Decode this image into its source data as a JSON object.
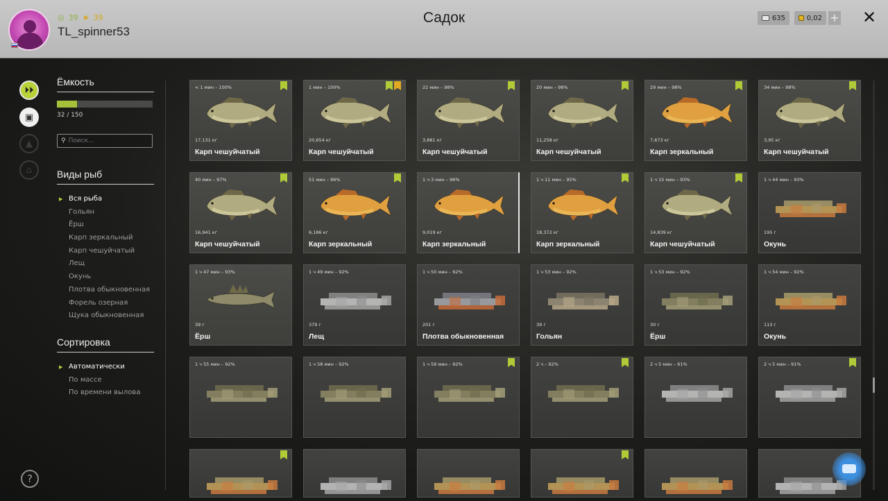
{
  "header": {
    "title": "Садок",
    "username": "TL_spinner53",
    "level": "39",
    "rank": "39",
    "silver": "635",
    "gold": "0,02",
    "plus": "+",
    "close": "✕"
  },
  "sidebar": {
    "capacity_title": "Ёмкость",
    "capacity_text": "32 / 150",
    "capacity_fraction": 0.213,
    "search_placeholder": "Поиск...",
    "species_title": "Виды рыб",
    "species": [
      "Вся рыба",
      "Гольян",
      "Ёрш",
      "Карп зеркальный",
      "Карп чешуйчатый",
      "Лещ",
      "Окунь",
      "Плотва обыкновенная",
      "Форель озерная",
      "Щука обыкновенная"
    ],
    "sort_title": "Сортировка",
    "sort_options": [
      "Автоматически",
      "По массе",
      "По времени вылова"
    ]
  },
  "help": "?",
  "colors": {
    "accent": "#b1cb38",
    "star": "#e3a923",
    "carp_scaled": "#b0ab80",
    "carp_mirror": "#e0a040",
    "perch": "#c9a35a"
  },
  "cards": [
    {
      "time": "< 1 мин – 100%",
      "weight": "17,131 кг",
      "name": "Карп чешуйчатый",
      "fish": "scaled",
      "badges": [
        "trophy"
      ]
    },
    {
      "time": "1 мин – 100%",
      "weight": "20,654 кг",
      "name": "Карп чешуйчатый",
      "fish": "scaled",
      "badges": [
        "trophy",
        "star"
      ]
    },
    {
      "time": "22 мин – 98%",
      "weight": "3,881 кг",
      "name": "Карп чешуйчатый",
      "fish": "scaled",
      "badges": [
        "trophy"
      ]
    },
    {
      "time": "20 мин – 98%",
      "weight": "11,258 кг",
      "name": "Карп чешуйчатый",
      "fish": "scaled",
      "badges": [
        "trophy"
      ]
    },
    {
      "time": "29 мин – 98%",
      "weight": "7,673 кг",
      "name": "Карп зеркальный",
      "fish": "mirror",
      "badges": [
        "trophy"
      ]
    },
    {
      "time": "34 мин – 98%",
      "weight": "3,95 кг",
      "name": "Карп чешуйчатый",
      "fish": "scaled",
      "badges": [
        "trophy"
      ]
    },
    {
      "time": "40 мин – 97%",
      "weight": "16,941 кг",
      "name": "Карп чешуйчатый",
      "fish": "scaled",
      "badges": [
        "trophy"
      ]
    },
    {
      "time": "51 мин – 96%",
      "weight": "6,186 кг",
      "name": "Карп зеркальный",
      "fish": "mirror",
      "badges": [
        "trophy"
      ]
    },
    {
      "time": "1 ч 3 мин – 96%",
      "weight": "9,019 кг",
      "name": "Карп зеркальный",
      "fish": "mirror",
      "badges": [],
      "selected": true
    },
    {
      "time": "1 ч 11 мин – 95%",
      "weight": "18,372 кг",
      "name": "Карп зеркальный",
      "fish": "mirror",
      "badges": [
        "trophy"
      ]
    },
    {
      "time": "1 ч 15 мин – 93%",
      "weight": "14,839 кг",
      "name": "Карп чешуйчатый",
      "fish": "scaled",
      "badges": [
        "trophy"
      ]
    },
    {
      "time": "1 ч 44 мин – 93%",
      "weight": "195 г",
      "name": "Окунь",
      "fish": "blur-perch",
      "badges": []
    },
    {
      "time": "1 ч 47 мин – 93%",
      "weight": "39 г",
      "name": "Ёрш",
      "fish": "ruffe",
      "badges": []
    },
    {
      "time": "1 ч 49 мин – 92%",
      "weight": "379 г",
      "name": "Лещ",
      "fish": "blur-white",
      "badges": []
    },
    {
      "time": "1 ч 50 мин – 92%",
      "weight": "201 г",
      "name": "Плотва обыкновенная",
      "fish": "blur-roach",
      "badges": []
    },
    {
      "time": "1 ч 53 мин – 92%",
      "weight": "39 г",
      "name": "Гольян",
      "fish": "blur-minnow",
      "badges": []
    },
    {
      "time": "1 ч 53 мин – 92%",
      "weight": "30 г",
      "name": "Ёрш",
      "fish": "blur-ruffe",
      "badges": []
    },
    {
      "time": "1 ч 54 мин – 92%",
      "weight": "113 г",
      "name": "Окунь",
      "fish": "blur-perch",
      "badges": []
    },
    {
      "time": "1 ч 55 мин – 92%",
      "weight": "",
      "name": "",
      "fish": "blur-ruffe",
      "badges": []
    },
    {
      "time": "1 ч 58 мин – 92%",
      "weight": "",
      "name": "",
      "fish": "blur-ruffe",
      "badges": []
    },
    {
      "time": "1 ч 59 мин – 92%",
      "weight": "",
      "name": "",
      "fish": "blur-ruffe",
      "badges": [
        "trophy"
      ]
    },
    {
      "time": "2 ч – 92%",
      "weight": "",
      "name": "",
      "fish": "blur-ruffe",
      "badges": [
        "trophy"
      ]
    },
    {
      "time": "2 ч 5 мин – 91%",
      "weight": "",
      "name": "",
      "fish": "blur-white",
      "badges": []
    },
    {
      "time": "2 ч 5 мин – 91%",
      "weight": "",
      "name": "",
      "fish": "blur-white",
      "badges": [
        "trophy"
      ]
    },
    {
      "time": "",
      "weight": "",
      "name": "",
      "fish": "blur-perch",
      "badges": [
        "trophy"
      ]
    },
    {
      "time": "",
      "weight": "",
      "name": "",
      "fish": "blur-white",
      "badges": []
    },
    {
      "time": "",
      "weight": "",
      "name": "",
      "fish": "blur-perch",
      "badges": []
    },
    {
      "time": "",
      "weight": "",
      "name": "",
      "fish": "blur-perch",
      "badges": [
        "trophy"
      ]
    },
    {
      "time": "",
      "weight": "",
      "name": "",
      "fish": "blur-perch",
      "badges": []
    },
    {
      "time": "",
      "weight": "",
      "name": "",
      "fish": "blur-white",
      "badges": []
    }
  ]
}
